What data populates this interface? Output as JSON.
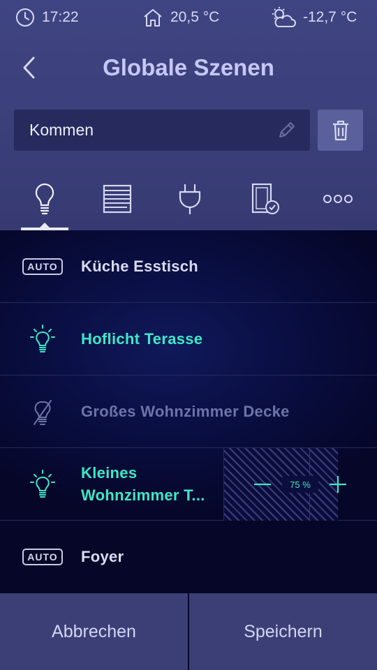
{
  "status_bar": {
    "time": "17:22",
    "indoor_temp": "20,5 °C",
    "outdoor_temp": "-12,7 °C",
    "icons": [
      "clock-icon",
      "home-icon",
      "partly-cloudy-icon"
    ]
  },
  "header": {
    "title": "Globale Szenen",
    "back_icon": "chevron-left-icon"
  },
  "scene_name": {
    "value": "Kommen",
    "edit_icon": "pencil-icon",
    "delete_icon": "trash-icon"
  },
  "tabs": [
    {
      "name": "light",
      "icon": "light-bulb-icon",
      "active": true
    },
    {
      "name": "blinds",
      "icon": "blinds-icon",
      "active": false
    },
    {
      "name": "sockets",
      "icon": "plug-icon",
      "active": false
    },
    {
      "name": "doors",
      "icon": "door-check-icon",
      "active": false
    },
    {
      "name": "more",
      "icon": "more-icon",
      "active": false
    }
  ],
  "devices": [
    {
      "label": "Küche Esstisch",
      "state": "auto",
      "badge": "AUTO"
    },
    {
      "label": "Hoflicht Terasse",
      "state": "on"
    },
    {
      "label": "Großes Wohnzimmer Decke",
      "state": "off"
    },
    {
      "label_line1": "Kleines",
      "label_line2": "Wohnzimmer T...",
      "state": "dimmed",
      "dim_value": "75 %",
      "dim_level": 0.75
    },
    {
      "label": "Foyer",
      "state": "auto",
      "badge": "AUTO"
    }
  ],
  "footer": {
    "cancel": "Abbrechen",
    "save": "Speichern"
  },
  "colors": {
    "accent": "#3ee8c6",
    "header_bg": "#3f4582",
    "list_bg": "#050628",
    "footer_bg": "#3b3f76"
  }
}
